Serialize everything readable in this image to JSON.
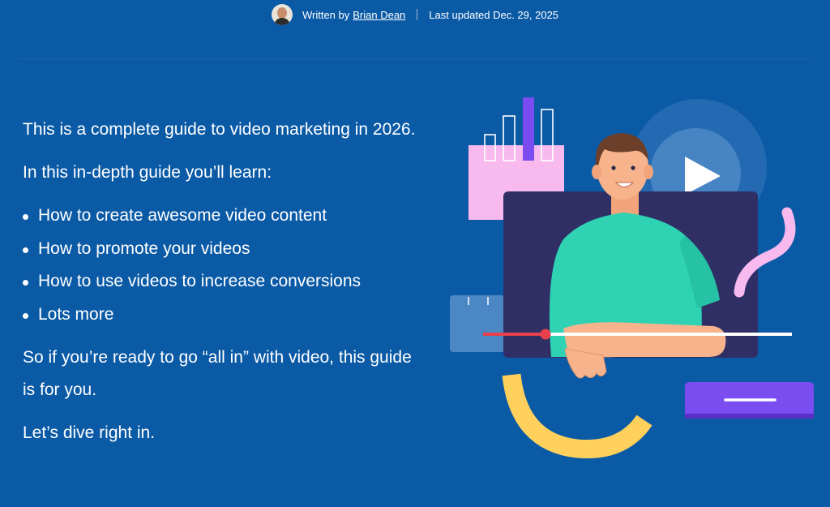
{
  "byline": {
    "written_by": "Written by",
    "author": "Brian Dean",
    "last_updated": "Last updated Dec. 29, 2025"
  },
  "content": {
    "intro": "This is a complete guide to video marketing in 2026.",
    "learn_heading": "In this in-depth guide you’ll learn:",
    "bullets": [
      "How to create awesome video content",
      "How to promote your videos",
      "How to use videos to increase conversions",
      "Lots more"
    ],
    "ready": "So if you’re ready to go “all in” with video, this guide is for you.",
    "dive": "Let’s dive right in."
  },
  "illustration": {
    "icon": "video-marketing-illustration",
    "colors": {
      "background": "#0a5aa6",
      "pink": "#f7b9ee",
      "purple": "#7b4cf0",
      "teal": "#2fd3b4",
      "yellow": "#ffd15c",
      "video_frame": "#2f2f66",
      "progress_red": "#e8404a"
    }
  }
}
